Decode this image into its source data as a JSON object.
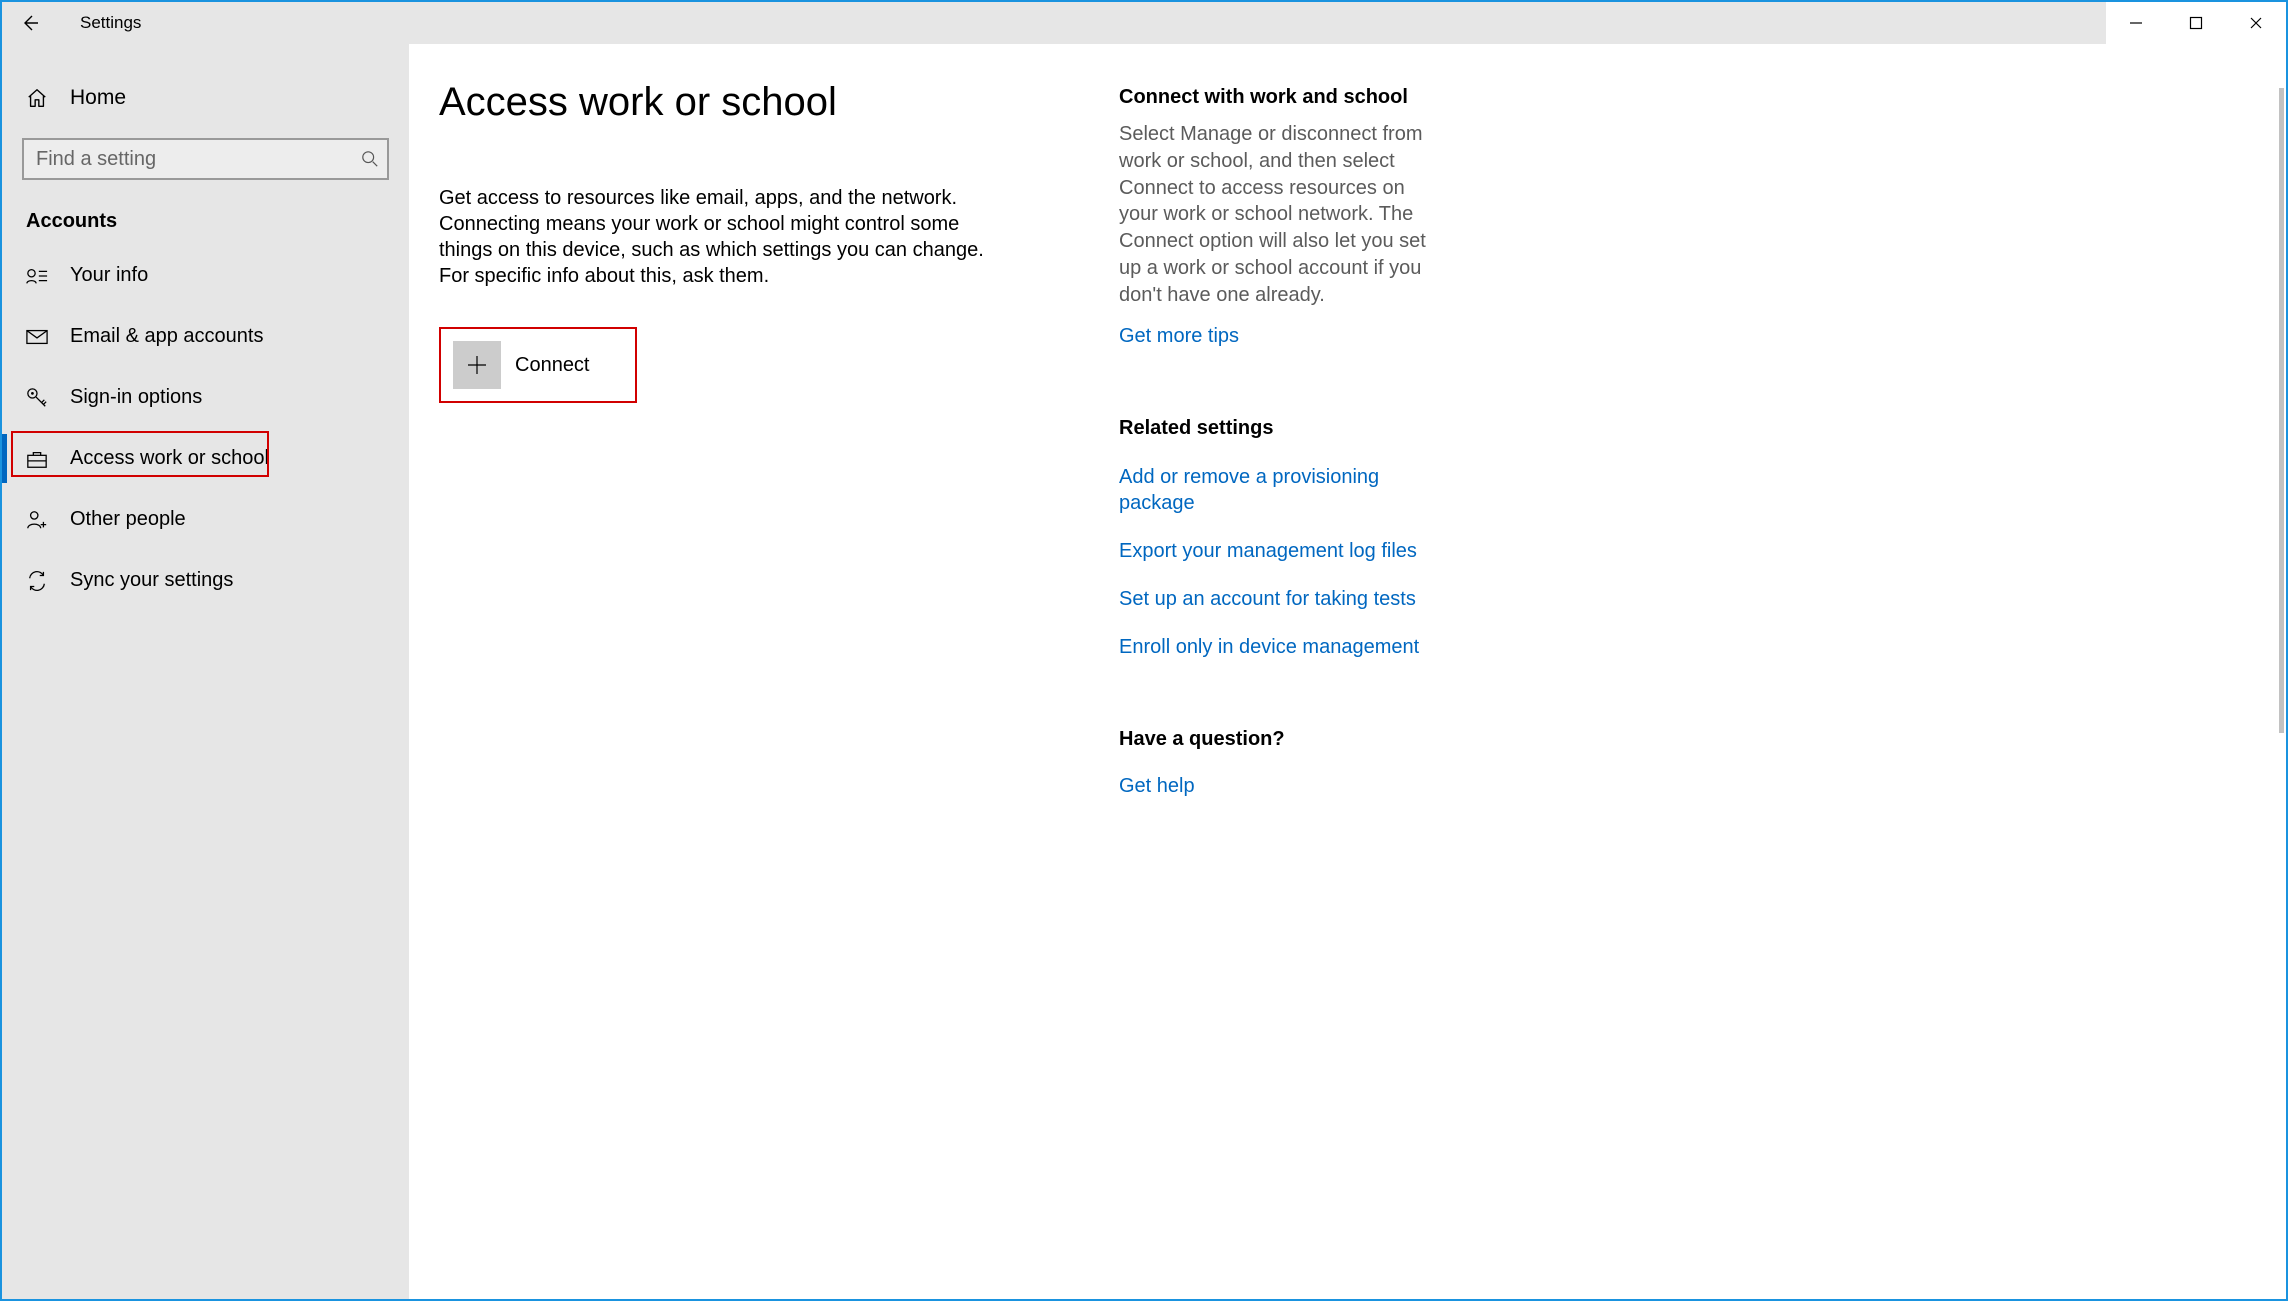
{
  "titlebar": {
    "title": "Settings"
  },
  "sidebar": {
    "home": "Home",
    "search_placeholder": "Find a setting",
    "category": "Accounts",
    "items": [
      {
        "label": "Your info"
      },
      {
        "label": "Email & app accounts"
      },
      {
        "label": "Sign-in options"
      },
      {
        "label": "Access work or school"
      },
      {
        "label": "Other people"
      },
      {
        "label": "Sync your settings"
      }
    ]
  },
  "content": {
    "heading": "Access work or school",
    "description": "Get access to resources like email, apps, and the network. Connecting means your work or school might control some things on this device, such as which settings you can change. For specific info about this, ask them.",
    "connect_label": "Connect"
  },
  "right": {
    "section1_heading": "Connect with work and school",
    "section1_text": "Select Manage or disconnect from work or school, and then select Connect to access resources on your work or school network. The Connect option will also let you set up a work or school account if you don't have one already.",
    "section1_link": "Get more tips",
    "section2_heading": "Related settings",
    "section2_links": [
      "Add or remove a provisioning package",
      "Export your management log files",
      "Set up an account for taking tests",
      "Enroll only in device management"
    ],
    "section3_heading": "Have a question?",
    "section3_link": "Get help"
  }
}
